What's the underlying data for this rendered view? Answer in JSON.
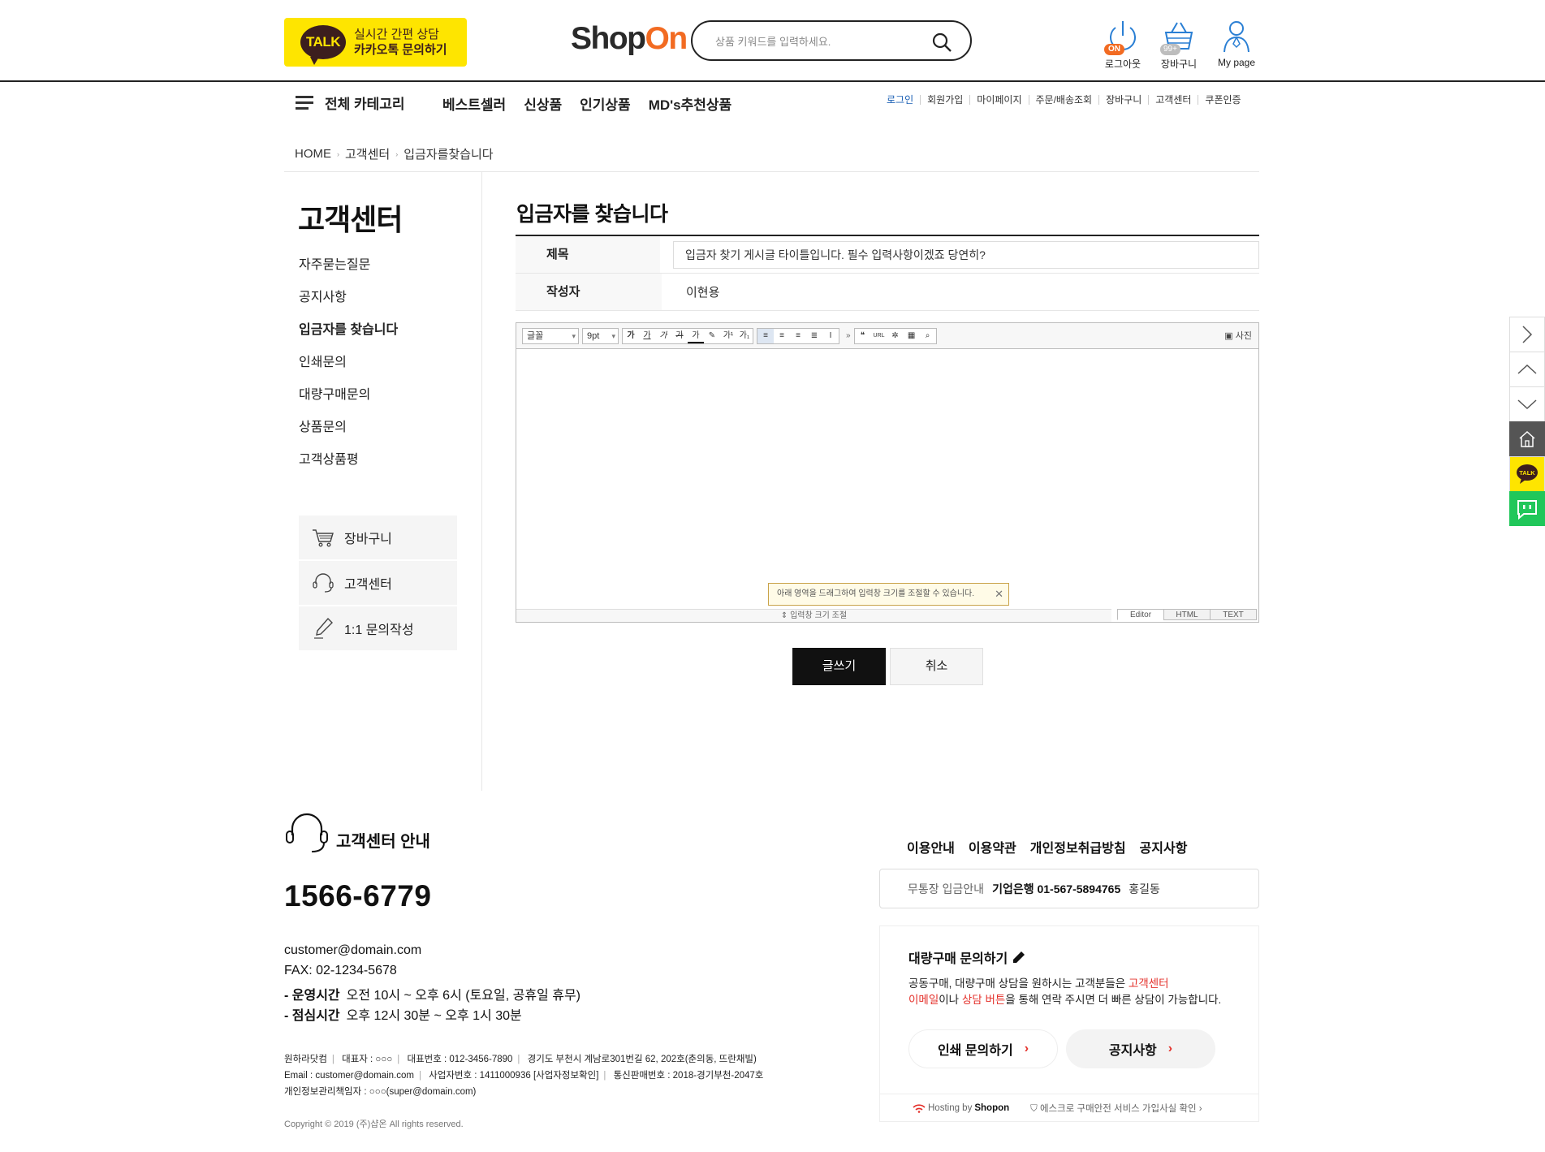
{
  "header": {
    "kakao_line1": "실시간 간편 상담",
    "kakao_line2": "카카오톡 문의하기",
    "talk": "TALK",
    "logo_shop": "Shop",
    "logo_on": "On",
    "search_placeholder": "상품 키워드를 입력하세요.",
    "icons": [
      {
        "label": "로그아웃",
        "badge": "ON"
      },
      {
        "label": "장바구니",
        "badge": "99+"
      },
      {
        "label": "My page"
      }
    ]
  },
  "nav": {
    "all_category": "전체 카테고리",
    "main": [
      "베스트셀러",
      "신상품",
      "인기상품",
      "MD's추천상품"
    ],
    "util": [
      "로그인",
      "회원가입",
      "마이페이지",
      "주문/배송조회",
      "장바구니",
      "고객센터",
      "쿠폰인증"
    ]
  },
  "breadcrumb": [
    "HOME",
    "고객센터",
    "입금자를찾습니다"
  ],
  "sidebar": {
    "title": "고객센터",
    "items": [
      "자주묻는질문",
      "공지사항",
      "입금자를 찾습니다",
      "인쇄문의",
      "대량구매문의",
      "상품문의",
      "고객상품평"
    ],
    "quick": [
      "장바구니",
      "고객센터",
      "1:1 문의작성"
    ]
  },
  "main": {
    "title": "입금자를 찾습니다",
    "subject_label": "제목",
    "subject_value": "입금자 찾기 게시글 타이틀입니다. 필수 입력사항이겠죠 당연히?",
    "author_label": "작성자",
    "author_value": "이현용",
    "editor": {
      "font": "글꼴",
      "size": "9pt",
      "photo": "사진",
      "tip": "아래 영역을 드래그하여 입력창 크기를 조절할 수 있습니다.",
      "resize": "입력창 크기 조절",
      "modes": [
        "Editor",
        "HTML",
        "TEXT"
      ]
    },
    "submit": "글쓰기",
    "cancel": "취소"
  },
  "footer": {
    "cs_title": "고객센터 안내",
    "phone": "1566-6779",
    "email": "customer@domain.com",
    "fax": "FAX: 02-1234-5678",
    "hours1_label": "- 운영시간",
    "hours1_value": "오전 10시 ~ 오후 6시 (토요일, 공휴일 휴무)",
    "hours2_label": "- 점심시간",
    "hours2_value": "오후 12시 30분 ~ 오후 1시 30분",
    "biz1": [
      "원하라닷컴",
      "대표자 : ○○○",
      "대표번호 : 012-3456-7890",
      "경기도 부천시 계남로301번길 62, 202호(춘의동, 뜨란채빌)"
    ],
    "biz2": [
      "Email : customer@domain.com",
      "사업자번호 : 1411000936 [사업자정보확인]",
      "통신판매번호 : 2018-경기부천-2047호"
    ],
    "biz3": "개인정보관리책임자 : ○○○(super@domain.com)",
    "copyright": "Copyright © 2019 (주)샵온 All rights reserved.",
    "links": [
      "이용안내",
      "이용약관",
      "개인정보취급방침",
      "공지사항"
    ],
    "bank_label": "무통장 입금안내",
    "bank_value": "기업은행 01-567-5894765",
    "bank_name": "홍길동",
    "bulk_title": "대량구매 문의하기",
    "bulk_desc1a": "공동구매, 대량구매 상담을 원하시는 고객분들은 ",
    "bulk_desc1b": "고객센터",
    "bulk_desc2a": "이메일",
    "bulk_desc2b": "이나 ",
    "bulk_desc2c": "상담 버튼",
    "bulk_desc2d": "을 통해 연락 주시면 더 빠른 상담이 가능합니다.",
    "pill1": "인쇄 문의하기",
    "pill2": "공지사항",
    "hosting": "Hosting by",
    "hosting_brand": "Shopon",
    "escrow": "에스크로 구매안전 서비스 가입사실 확인"
  },
  "colors": {
    "accent": "#f26b22",
    "kakao": "#fee500",
    "red": "#e4312b",
    "link_blue": "#1a5fb4"
  }
}
